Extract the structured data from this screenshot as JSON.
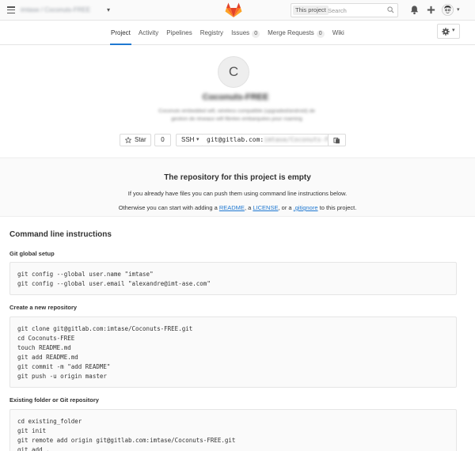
{
  "header": {
    "group_project": "imtase / Coconuts-FREE",
    "search_scope": "This project",
    "search_placeholder": "Search"
  },
  "nav": {
    "tabs": [
      {
        "label": "Project",
        "badge": null,
        "active": true
      },
      {
        "label": "Activity",
        "badge": null,
        "active": false
      },
      {
        "label": "Pipelines",
        "badge": null,
        "active": false
      },
      {
        "label": "Registry",
        "badge": null,
        "active": false
      },
      {
        "label": "Issues",
        "badge": "0",
        "active": false
      },
      {
        "label": "Merge Requests",
        "badge": "0",
        "active": false
      },
      {
        "label": "Wiki",
        "badge": null,
        "active": false
      }
    ]
  },
  "project": {
    "avatar_letter": "C",
    "title": "Coconuts-FREE",
    "description": "Coconuts embedded wifi, wireless compatible (upgraded/android) de gestion de réseaux wifi fibrées embarquées pour roaming",
    "star_label": "Star",
    "star_count": "0",
    "protocol": "SSH",
    "clone_prefix": "git@gitlab.com:",
    "clone_rest": "imtase/Coconuts-FREE.git"
  },
  "empty": {
    "title": "The repository for this project is empty",
    "line1": "If you already have files you can push them using command line instructions below.",
    "line2_pre": "Otherwise you can start with adding a ",
    "readme": "README",
    "sep1": ", a ",
    "license": "LICENSE",
    "sep2": ", or a ",
    "gitignore": ".gitignore",
    "line2_post": " to this project."
  },
  "instructions": {
    "title": "Command line instructions",
    "sections": [
      {
        "title": "Git global setup",
        "code": "git config --global user.name \"imtase\"\ngit config --global user.email \"alexandre@imt-ase.com\""
      },
      {
        "title": "Create a new repository",
        "code": "git clone git@gitlab.com:imtase/Coconuts-FREE.git\ncd Coconuts-FREE\ntouch README.md\ngit add README.md\ngit commit -m \"add README\"\ngit push -u origin master"
      },
      {
        "title": "Existing folder or Git repository",
        "code": "cd existing_folder\ngit init\ngit remote add origin git@gitlab.com:imtase/Coconuts-FREE.git\ngit add ."
      }
    ]
  },
  "icons": {
    "menu": "hamburger-icon",
    "logo": "gitlab-tanuki-logo",
    "search": "search-icon",
    "notifications": "bell-icon",
    "new": "plus-icon",
    "avatar": "user-avatar",
    "settings": "gear-icon",
    "star": "star-icon",
    "copy": "clipboard-icon"
  },
  "colors": {
    "accent": "#1f78d1",
    "logo_orange": "#fc6d26",
    "logo_red": "#e24329",
    "logo_light": "#fca326"
  }
}
